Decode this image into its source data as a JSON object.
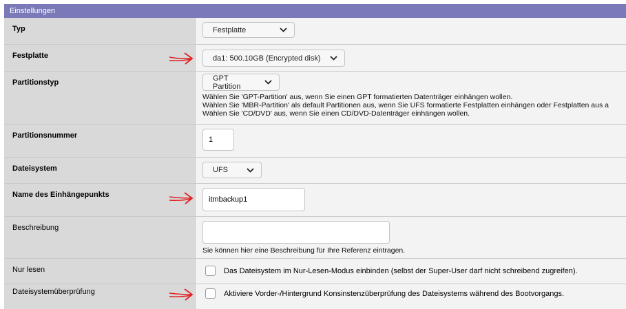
{
  "panel": {
    "title": "Einstellungen"
  },
  "rows": {
    "typ": {
      "label": "Typ",
      "value": "Festplatte"
    },
    "festplatte": {
      "label": "Festplatte",
      "value": "da1: 500.10GB (Encrypted disk)"
    },
    "partitionstyp": {
      "label": "Partitionstyp",
      "value": "GPT Partition",
      "help": [
        "Wählen Sie 'GPT-Partition' aus, wenn Sie einen GPT formatierten Datenträger einhängen wollen.",
        "Wählen Sie 'MBR-Partition' als default Partitionen aus, wenn Sie UFS formatierte Festplatten einhängen oder Festplatten aus a",
        "Wählen Sie 'CD/DVD' aus, wenn Sie einen CD/DVD-Datenträger einhängen wollen."
      ]
    },
    "partitionsnummer": {
      "label": "Partitionsnummer",
      "value": "1"
    },
    "dateisystem": {
      "label": "Dateisystem",
      "value": "UFS"
    },
    "mountpoint": {
      "label": "Name des Einhängepunkts",
      "value": "itmbackup1"
    },
    "beschreibung": {
      "label": "Beschreibung",
      "value": "",
      "help": "Sie können hier eine Beschreibung für Ihre Referenz eintragen."
    },
    "nurlesen": {
      "label": "Nur lesen",
      "checkbox_text": "Das Dateisystem im Nur-Lesen-Modus einbinden (selbst der Super-User darf nicht schreibend zugreifen)."
    },
    "fscheck": {
      "label": "Dateisystemüberprüfung",
      "checkbox_text": "Aktiviere Vorder-/Hintergrund Konsinstenzüberprüfung des Dateisystems während des Bootvorgangs."
    }
  },
  "colors": {
    "header_bg": "#7a7ab8",
    "label_bg": "#d9d9d9",
    "field_bg": "#f3f3f3",
    "annotation_red": "#e02020"
  },
  "icons": {
    "dropdown": "chevron-down-icon",
    "annotation": "red-arrow-icon"
  }
}
